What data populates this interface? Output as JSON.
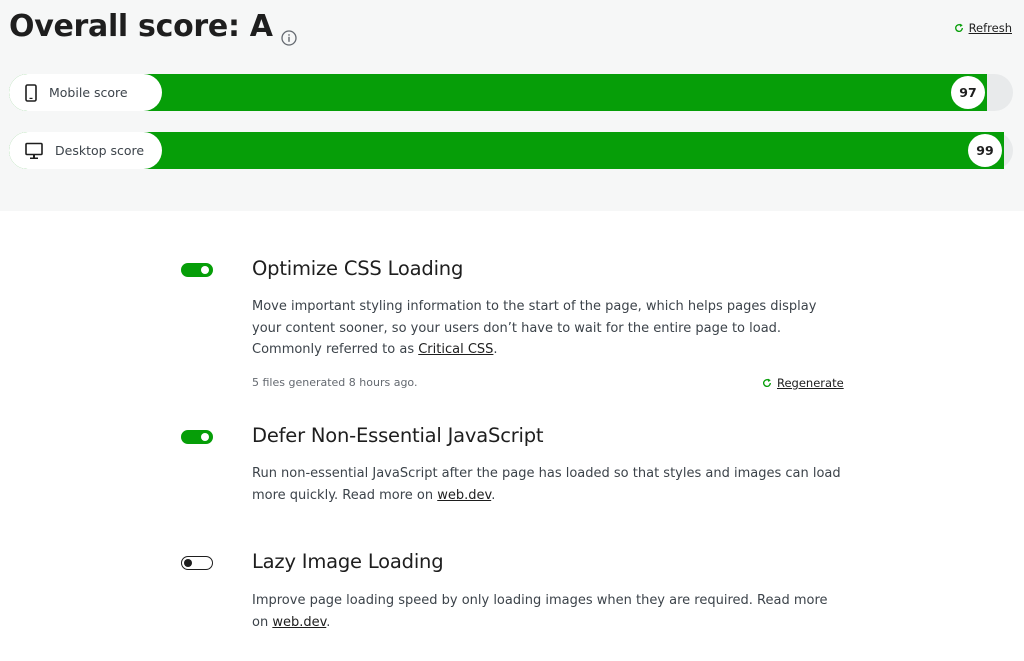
{
  "header": {
    "title": "Overall score: A",
    "info_icon": "info-icon",
    "refresh_label": "Refresh",
    "refresh_icon": "refresh-icon"
  },
  "scores": [
    {
      "label": "Mobile score",
      "icon": "mobile-phone-icon",
      "value": "97",
      "fill_percent": 97
    },
    {
      "label": "Desktop score",
      "icon": "desktop-monitor-icon",
      "value": "99",
      "fill_percent": 99
    }
  ],
  "modules": [
    {
      "title": "Optimize CSS Loading",
      "enabled": true,
      "desc_before": "Move important styling information to the start of the page, which helps pages display your content sooner, so your users don’t have to wait for the entire page to load. Commonly referred to as ",
      "link_text": "Critical CSS",
      "desc_after": ".",
      "meta": "5 files generated 8 hours ago.",
      "regenerate_label": "Regenerate"
    },
    {
      "title": "Defer Non-Essential JavaScript",
      "enabled": true,
      "desc_before": "Run non-essential JavaScript after the page has loaded so that styles and images can load more quickly. Read more on ",
      "link_text": "web.dev",
      "desc_after": "."
    },
    {
      "title": "Lazy Image Loading",
      "enabled": false,
      "desc_before": "Improve page loading speed by only loading images when they are required. Read more on ",
      "link_text": "web.dev",
      "desc_after": "."
    }
  ],
  "colors": {
    "accent_green": "#069e08",
    "header_bg": "#f6f7f7",
    "track": "#e8eaeb"
  }
}
